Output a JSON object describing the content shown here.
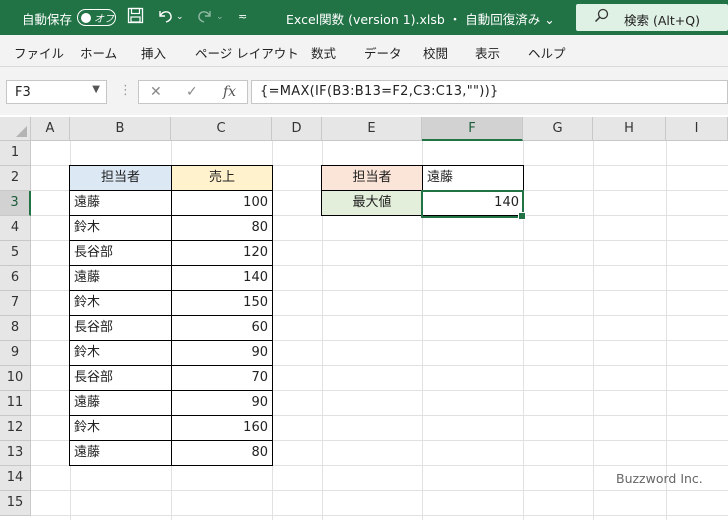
{
  "titlebar": {
    "autosave_label": "自動保存",
    "autosave_state": "オフ",
    "save_icon": "save-icon",
    "undo_icon": "undo-icon",
    "redo_icon": "redo-icon",
    "customize_icon": "customize-qat-icon",
    "title": "Excel関数 (version 1).xlsb ・ 自動回復済み ⌄",
    "search_label": "検索 (Alt+Q)",
    "search_icon": "search-icon"
  },
  "ribbon": {
    "tabs": [
      "ファイル",
      "ホーム",
      "挿入",
      "ページ レイアウト",
      "数式",
      "データ",
      "校閲",
      "表示",
      "ヘルプ"
    ]
  },
  "formula_bar": {
    "name_box": "F3",
    "formula": "{=MAX(IF(B3:B13=F2,C3:C13,\"\"))}",
    "cancel_symbol": "✕",
    "enter_symbol": "✓",
    "fx_symbol": "fx"
  },
  "sheet": {
    "columns": [
      "A",
      "B",
      "C",
      "D",
      "E",
      "F",
      "G",
      "H",
      "I"
    ],
    "rows": [
      "1",
      "2",
      "3",
      "4",
      "5",
      "6",
      "7",
      "8",
      "9",
      "10",
      "11",
      "12",
      "13",
      "14",
      "15"
    ],
    "selected_column": "F",
    "selected_row": "3",
    "table_headers": {
      "person": "担当者",
      "sales": "売上"
    },
    "table_rows": [
      {
        "name": "遠藤",
        "value": "100"
      },
      {
        "name": "鈴木",
        "value": "80"
      },
      {
        "name": "長谷部",
        "value": "120"
      },
      {
        "name": "遠藤",
        "value": "140"
      },
      {
        "name": "鈴木",
        "value": "150"
      },
      {
        "name": "長谷部",
        "value": "60"
      },
      {
        "name": "鈴木",
        "value": "90"
      },
      {
        "name": "長谷部",
        "value": "70"
      },
      {
        "name": "遠藤",
        "value": "90"
      },
      {
        "name": "鈴木",
        "value": "160"
      },
      {
        "name": "遠藤",
        "value": "80"
      }
    ],
    "lookup": {
      "label_person": "担当者",
      "value_person": "遠藤",
      "label_max": "最大値",
      "value_max": "140"
    },
    "colors": {
      "header_person_bg": "#dce9f5",
      "header_sales_bg": "#fff2cc",
      "lookup_person_bg": "#fbe4d8",
      "lookup_max_bg": "#e3efda",
      "accent": "#217346"
    }
  },
  "watermark": "Buzzword Inc."
}
